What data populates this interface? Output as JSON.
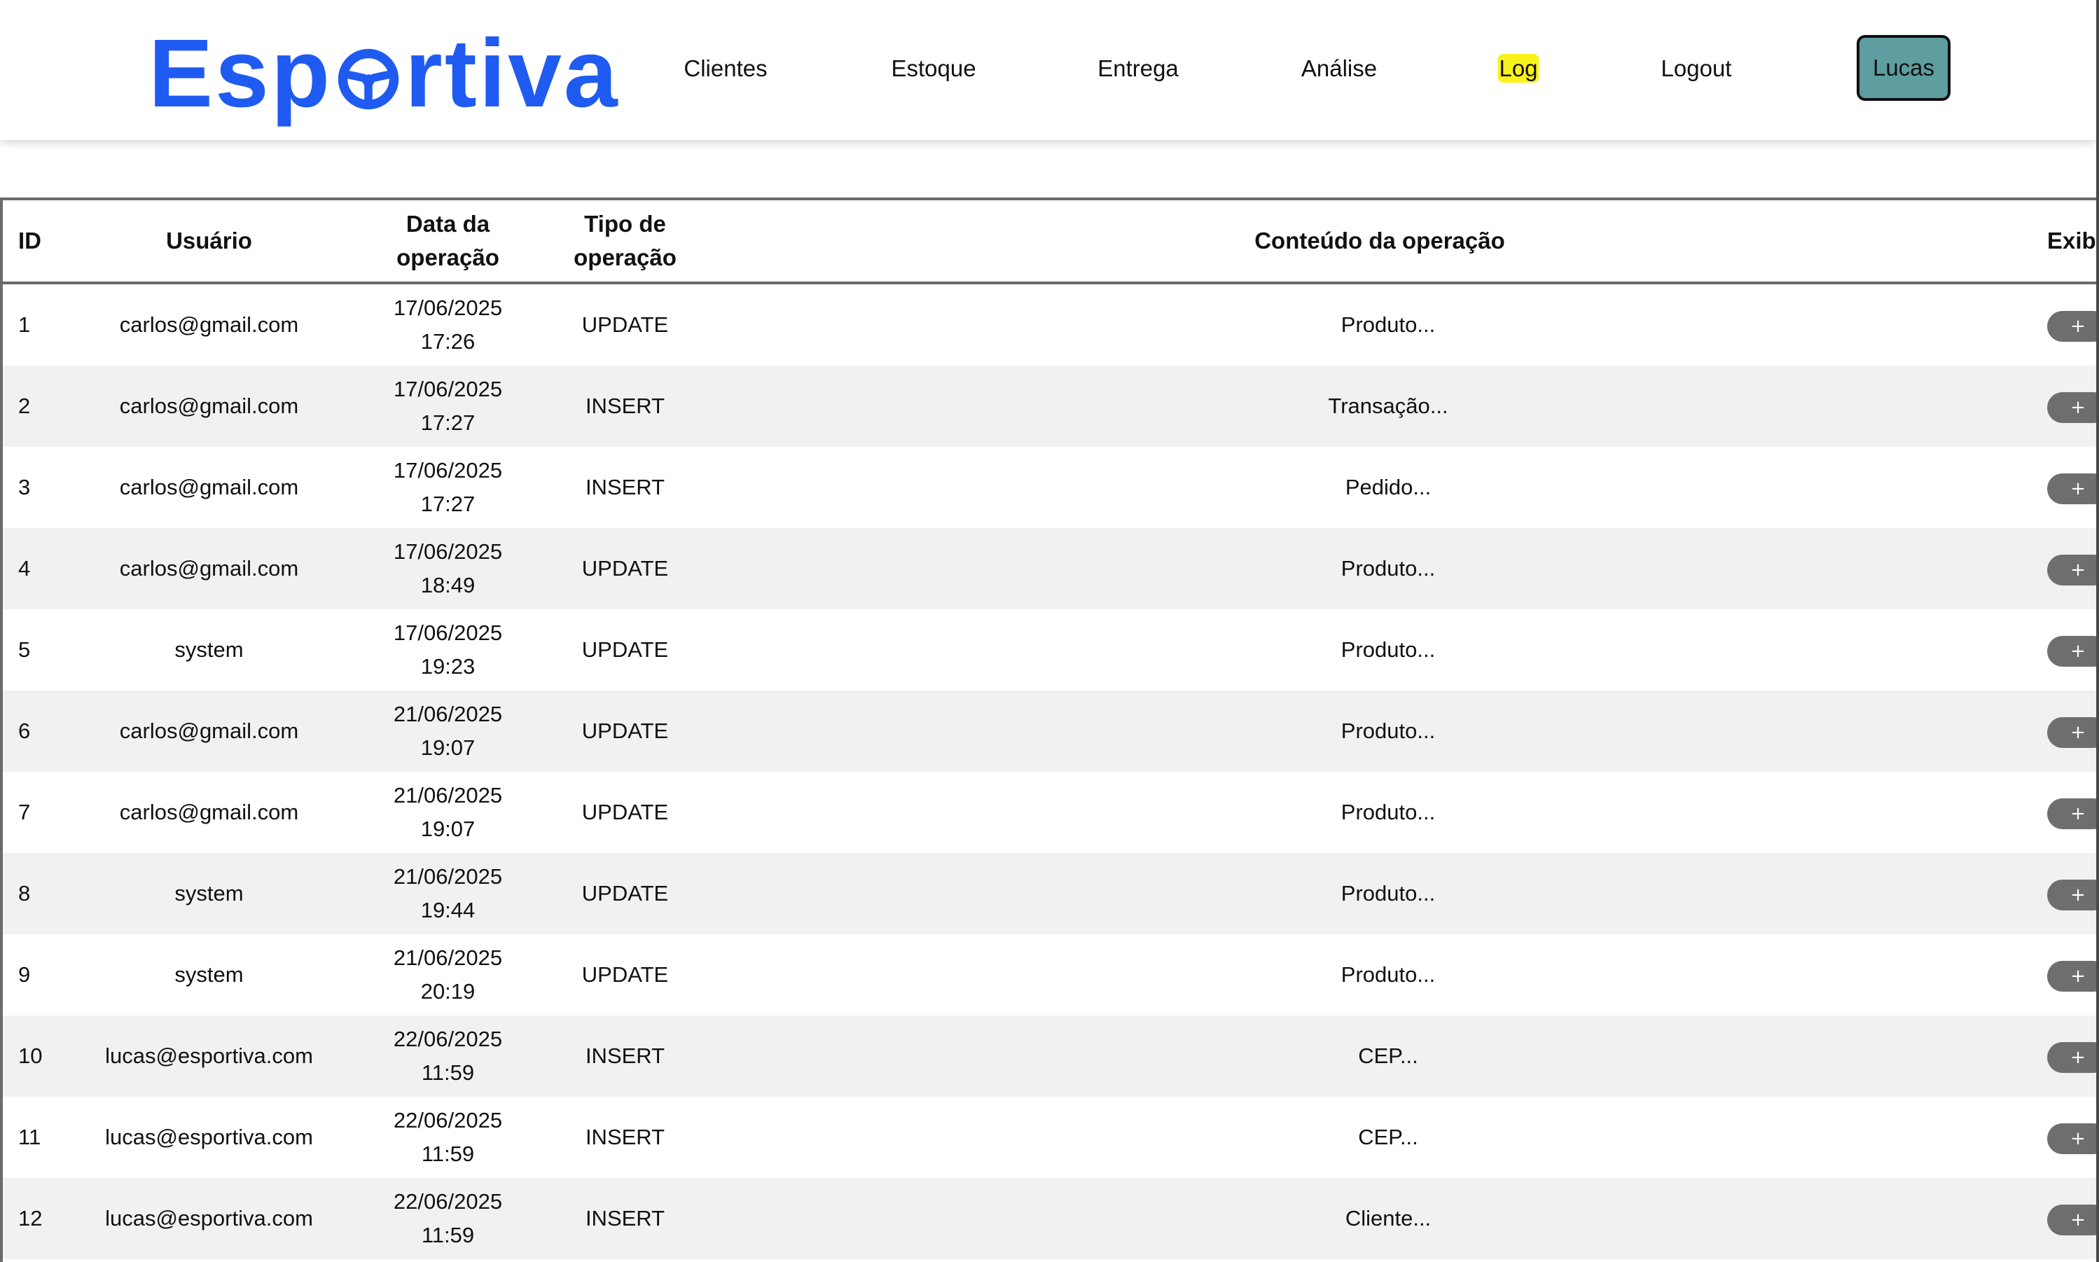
{
  "brand": {
    "name_before": "Esp",
    "name_after": "rtiva",
    "color": "#1f5bf0"
  },
  "nav": {
    "items": [
      {
        "label": "Clientes"
      },
      {
        "label": "Estoque"
      },
      {
        "label": "Entrega"
      },
      {
        "label": "Análise"
      },
      {
        "label": "Log"
      },
      {
        "label": "Logout"
      }
    ],
    "active_item": "Log",
    "active_highlight_color": "#f8f21a",
    "user_button_label": "Lucas",
    "user_button_color": "#5f9ea0"
  },
  "table": {
    "headers": {
      "id": "ID",
      "user": "Usuário",
      "date": "Data da operação",
      "type": "Tipo de operação",
      "content": "Conteúdo da operação",
      "show": "Exibir"
    },
    "show_button_label": "+",
    "rows": [
      {
        "id": "1",
        "user": "carlos@gmail.com",
        "date": "17/06/2025",
        "time": "17:26",
        "type": "UPDATE",
        "content": "Produto..."
      },
      {
        "id": "2",
        "user": "carlos@gmail.com",
        "date": "17/06/2025",
        "time": "17:27",
        "type": "INSERT",
        "content": "Transação..."
      },
      {
        "id": "3",
        "user": "carlos@gmail.com",
        "date": "17/06/2025",
        "time": "17:27",
        "type": "INSERT",
        "content": "Pedido..."
      },
      {
        "id": "4",
        "user": "carlos@gmail.com",
        "date": "17/06/2025",
        "time": "18:49",
        "type": "UPDATE",
        "content": "Produto..."
      },
      {
        "id": "5",
        "user": "system",
        "date": "17/06/2025",
        "time": "19:23",
        "type": "UPDATE",
        "content": "Produto..."
      },
      {
        "id": "6",
        "user": "carlos@gmail.com",
        "date": "21/06/2025",
        "time": "19:07",
        "type": "UPDATE",
        "content": "Produto..."
      },
      {
        "id": "7",
        "user": "carlos@gmail.com",
        "date": "21/06/2025",
        "time": "19:07",
        "type": "UPDATE",
        "content": "Produto..."
      },
      {
        "id": "8",
        "user": "system",
        "date": "21/06/2025",
        "time": "19:44",
        "type": "UPDATE",
        "content": "Produto..."
      },
      {
        "id": "9",
        "user": "system",
        "date": "21/06/2025",
        "time": "20:19",
        "type": "UPDATE",
        "content": "Produto..."
      },
      {
        "id": "10",
        "user": "lucas@esportiva.com",
        "date": "22/06/2025",
        "time": "11:59",
        "type": "INSERT",
        "content": "CEP..."
      },
      {
        "id": "11",
        "user": "lucas@esportiva.com",
        "date": "22/06/2025",
        "time": "11:59",
        "type": "INSERT",
        "content": "CEP..."
      },
      {
        "id": "12",
        "user": "lucas@esportiva.com",
        "date": "22/06/2025",
        "time": "11:59",
        "type": "INSERT",
        "content": "Cliente..."
      }
    ]
  }
}
